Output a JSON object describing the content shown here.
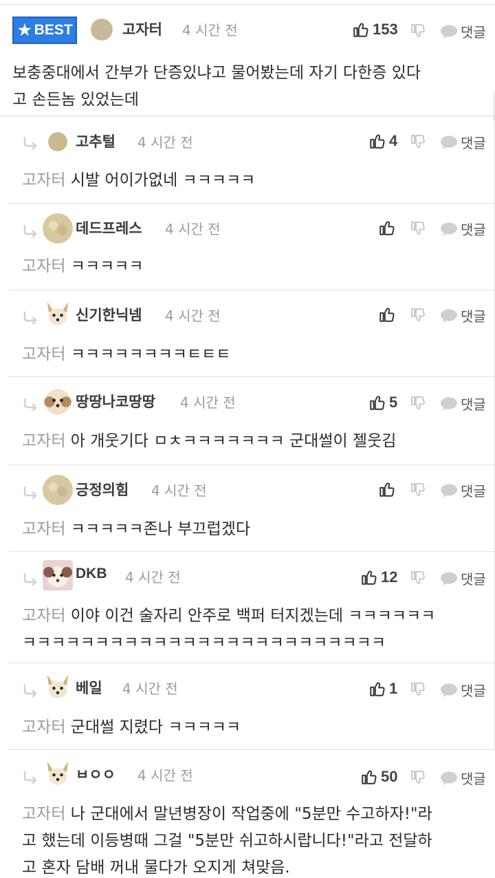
{
  "best": {
    "badge_label": "BEST",
    "nick": "고자터",
    "time": "4 시간 전",
    "likes": "153",
    "reply_label": "댓글",
    "text_line1": "보충중대에서 간부가 단증있냐고 물어봤는데 자기 다한증 있다",
    "text_line2": "고 손든놈 있었는데"
  },
  "replies": [
    {
      "nick": "고추털",
      "time": "4 시간 전",
      "likes": "4",
      "reply_label": "댓글",
      "mention": "고자터",
      "text": "시발 어이가없네 ㅋㅋㅋㅋㅋ"
    },
    {
      "nick": "데드프레스",
      "time": "4 시간 전",
      "likes": "",
      "reply_label": "댓글",
      "mention": "고자터",
      "text": "ㅋㅋㅋㅋㅋ"
    },
    {
      "nick": "신기한닉넴",
      "time": "4 시간 전",
      "likes": "",
      "reply_label": "댓글",
      "mention": "고자터",
      "text": "ㅋㅋㅋㅋㅋㅋㅋㅋㅌㅌㅌ"
    },
    {
      "nick": "땅땅나코땅땅",
      "time": "4 시간 전",
      "likes": "5",
      "reply_label": "댓글",
      "mention": "고자터",
      "text": "아 개웃기다 ㅁㅊㅋㅋㅋㅋㅋㅋㅋ 군대썰이 젤웃김"
    },
    {
      "nick": "긍정의힘",
      "time": "4 시간 전",
      "likes": "",
      "reply_label": "댓글",
      "mention": "고자터",
      "text": "ㅋㅋㅋㅋㅋ존나 부끄럽겠다"
    },
    {
      "nick": "DKB",
      "time": "4 시간 전",
      "likes": "12",
      "reply_label": "댓글",
      "mention": "고자터",
      "text": "이야 이건 술자리 안주로 백퍼 터지겠는데 ㅋㅋㅋㅋㅋㅋ",
      "text2": "ㅋㅋㅋㅋㅋㅋㅋㅋㅋㅋㅋㅋㅋㅋㅋㅋㅋㅋㅋㅋㅋㅋㅋㅋㅋ"
    },
    {
      "nick": "베일",
      "time": "4 시간 전",
      "likes": "1",
      "reply_label": "댓글",
      "mention": "고자터",
      "text": "군대썰 지렸다 ㅋㅋㅋㅋㅋ"
    },
    {
      "nick": "ㅂㅇㅇ",
      "time": "4 시간 전",
      "likes": "50",
      "reply_label": "댓글",
      "mention": "고자터",
      "text": "나 군대에서 말년병장이 작업중에 \"5분만 수고하자!\"라",
      "text2": "고 했는데 이등병때 그걸 \"5분만 쉬고하시랍니다!\"라고 전달하",
      "text3": "고 혼자 담배 꺼내 물다가 오지게 쳐맞음."
    }
  ],
  "icons": {
    "thumb_up": "thumb-up-icon",
    "thumb_down": "thumb-down-icon",
    "speech": "speech-bubble-icon",
    "reply_arrow": "reply-arrow-icon",
    "star": "star-icon"
  },
  "colors": {
    "badge": "#2e7de1",
    "mention": "#9a9a9a"
  }
}
